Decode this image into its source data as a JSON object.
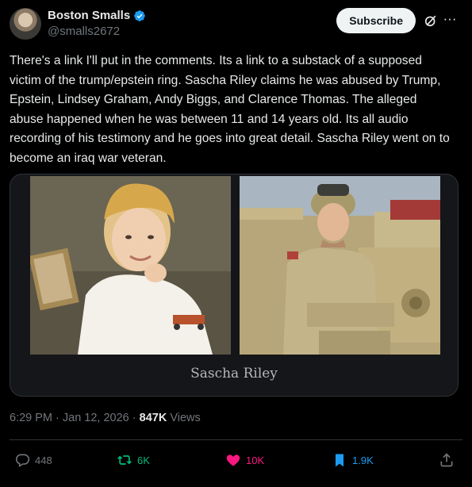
{
  "author": {
    "display_name": "Boston Smalls",
    "handle": "@smalls2672"
  },
  "header": {
    "subscribe_label": "Subscribe",
    "more_label": "···"
  },
  "tweet": {
    "text": "There's a link I'll put in the comments. Its a link to a substack of a supposed victim of the trump/epstein ring. Sascha Riley claims he was abused by Trump, Epstein, Lindsey Graham, Andy Biggs, and Clarence Thomas. The alleged abuse happened when he was between 11 and 14 years old. Its all audio recording of his testimony and he goes into great detail. Sascha Riley went on to become an iraq war veteran.",
    "media_caption": "Sascha Riley",
    "timestamp": "6:29 PM · Jan 12, 2026 · ",
    "views_count": "847K",
    "views_label": " Views"
  },
  "actions": {
    "replies": "448",
    "reposts": "6K",
    "likes": "10K",
    "bookmarks": "1.9K"
  },
  "colors": {
    "background": "#000000",
    "verified": "#1d9bf0",
    "repost": "#00ba7c",
    "like": "#f91880",
    "bookmark": "#1d9bf0",
    "muted": "#71767b"
  },
  "icons": {
    "verified": "verified-badge-icon",
    "grok": "grok-icon",
    "reply": "reply-icon",
    "repost": "repost-icon",
    "like": "heart-icon",
    "bookmark": "bookmark-icon",
    "share": "share-icon"
  }
}
